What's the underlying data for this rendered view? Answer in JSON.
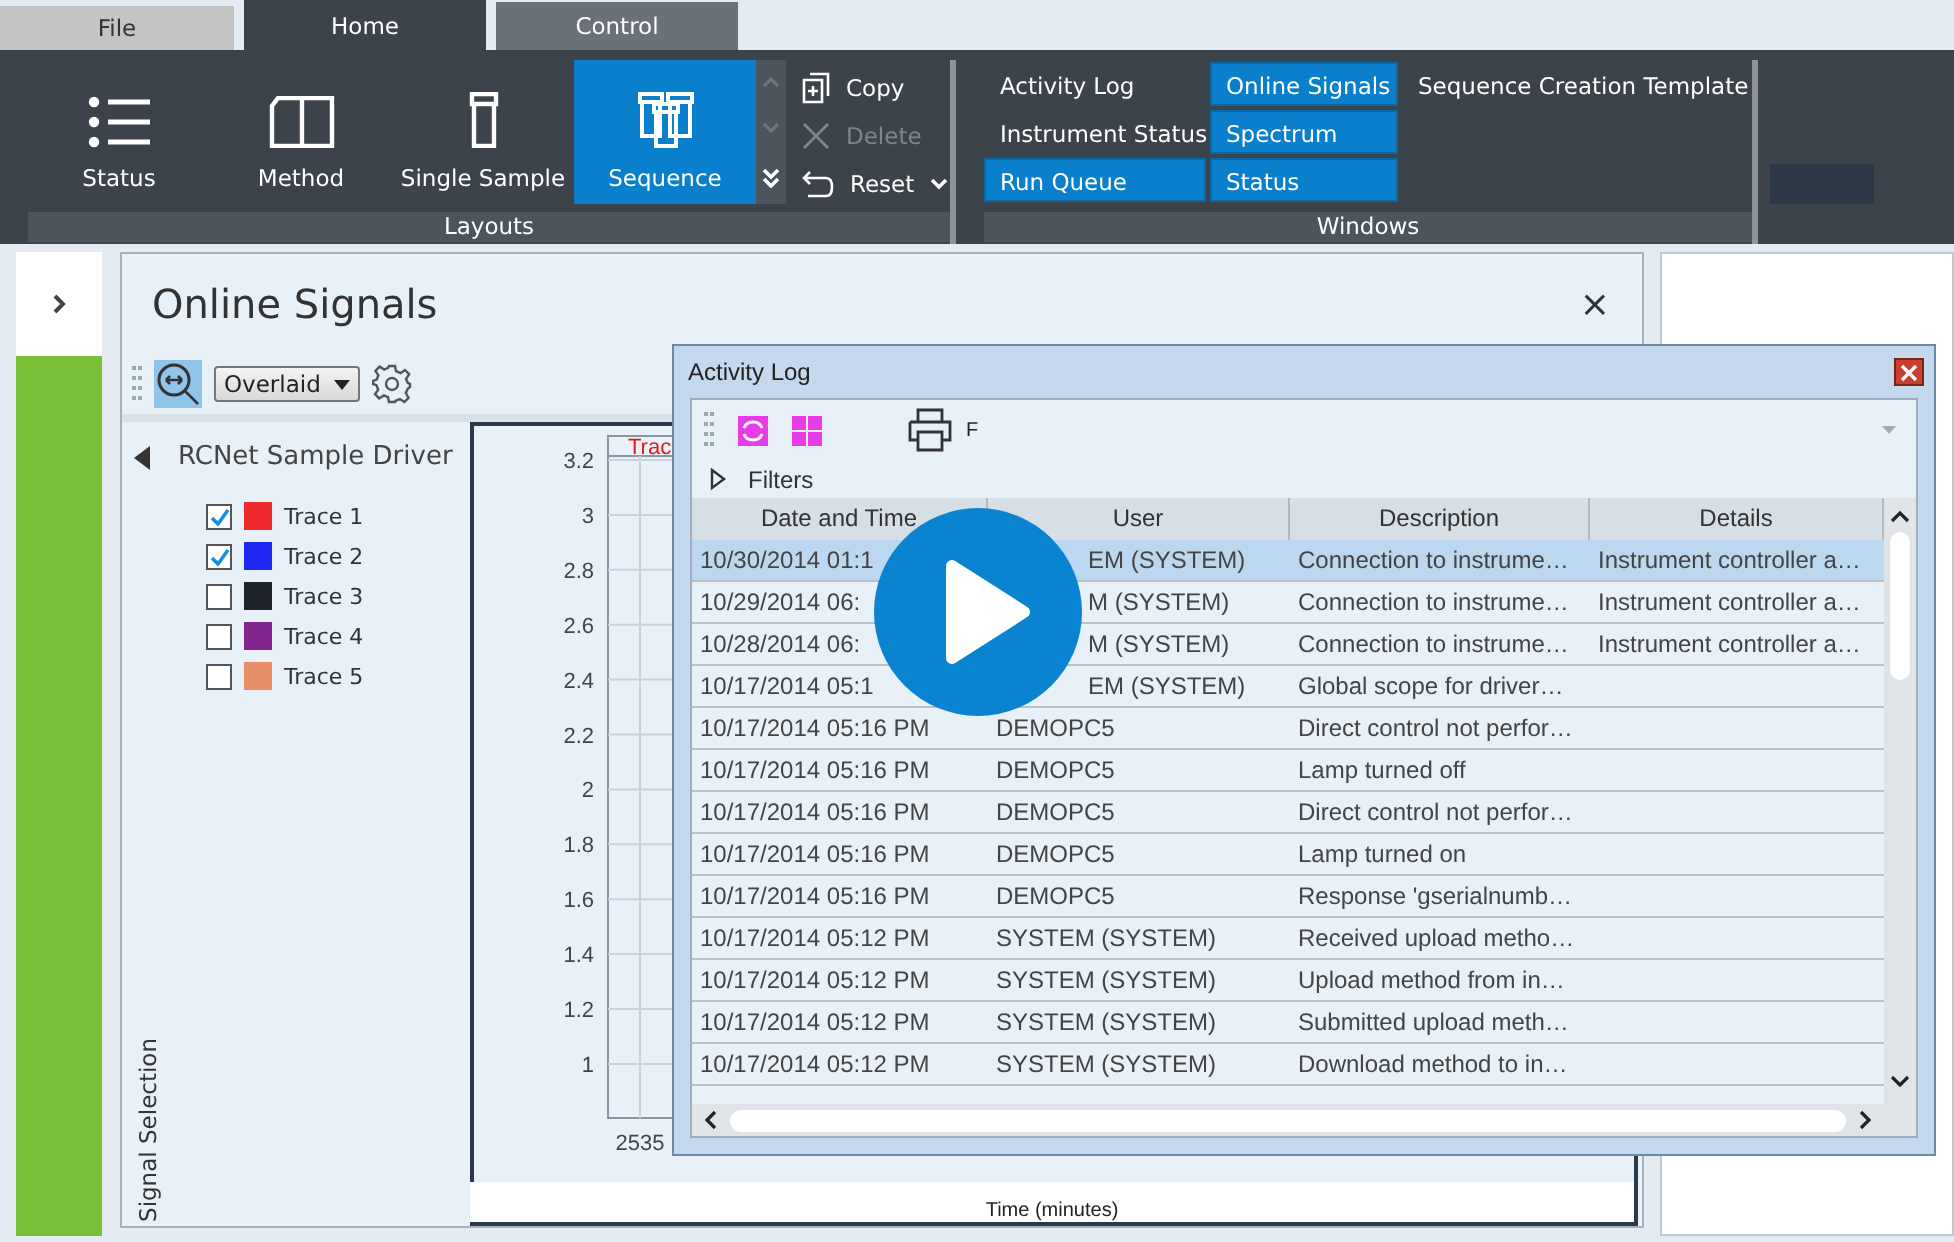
{
  "ribbon_tabs": [
    {
      "label": "File",
      "selected": false
    },
    {
      "label": "Home",
      "selected": true
    },
    {
      "label": "Control",
      "selected": false
    }
  ],
  "layouts": {
    "label": "Layouts",
    "buttons": [
      {
        "label": "Status",
        "selected": false
      },
      {
        "label": "Method",
        "selected": false
      },
      {
        "label": "Single Sample",
        "selected": false
      },
      {
        "label": "Sequence",
        "selected": true
      }
    ],
    "actions": [
      {
        "label": "Copy",
        "disabled": false
      },
      {
        "label": "Delete",
        "disabled": true
      },
      {
        "label": "Reset",
        "disabled": false
      }
    ]
  },
  "windows": {
    "label": "Windows",
    "columns": [
      [
        {
          "label": "Activity Log",
          "selected": false
        },
        {
          "label": "Instrument Status",
          "selected": false
        },
        {
          "label": "Run Queue",
          "selected": true
        }
      ],
      [
        {
          "label": "Online Signals",
          "selected": true
        },
        {
          "label": "Spectrum",
          "selected": true
        },
        {
          "label": "Status",
          "selected": true
        }
      ],
      [
        {
          "label": "Sequence Creation Template",
          "selected": false
        }
      ]
    ]
  },
  "online_signals": {
    "title": "Online Signals",
    "close": "×",
    "view_mode": "Overlaid",
    "driver": "RCNet Sample Driver",
    "side_label": "Signal Selection",
    "traces": [
      {
        "label": "Trace 1",
        "checked": true,
        "color": "#ee2a2e"
      },
      {
        "label": "Trace 2",
        "checked": true,
        "color": "#1f27f5"
      },
      {
        "label": "Trace 3",
        "checked": false,
        "color": "#1e2229"
      },
      {
        "label": "Trace 4",
        "checked": false,
        "color": "#822390"
      },
      {
        "label": "Trace 5",
        "checked": false,
        "color": "#e88e68"
      }
    ],
    "plot": {
      "legend_label": "Trac",
      "y_ticks": [
        "3.2",
        "3",
        "2.8",
        "2.6",
        "2.4",
        "2.2",
        "2",
        "1.8",
        "1.6",
        "1.4",
        "1.2",
        "1"
      ],
      "x_ticks": [
        "2535"
      ],
      "x_label": "Time (minutes)"
    }
  },
  "activity_log": {
    "title": "Activity Log",
    "toolbar_text": "F",
    "filters": "Filters",
    "columns": [
      "Date and Time",
      "User",
      "Description",
      "Details"
    ],
    "rows": [
      {
        "cells": [
          "10/30/2014 01:1",
          "EM (SYSTEM)",
          "Connection to instrume…",
          "Instrument controller a…"
        ],
        "selected": true
      },
      {
        "cells": [
          "10/29/2014 06:",
          "M (SYSTEM)",
          "Connection to instrume…",
          "Instrument controller a…"
        ],
        "selected": false
      },
      {
        "cells": [
          "10/28/2014 06:",
          "M (SYSTEM)",
          "Connection to instrume…",
          "Instrument controller a…"
        ],
        "selected": false
      },
      {
        "cells": [
          "10/17/2014 05:1",
          "EM (SYSTEM)",
          "Global scope for driver…",
          ""
        ],
        "selected": false
      },
      {
        "cells": [
          "10/17/2014 05:16 PM",
          "DEMOPC5",
          "Direct control not perfor…",
          ""
        ],
        "selected": false
      },
      {
        "cells": [
          "10/17/2014 05:16 PM",
          "DEMOPC5",
          "Lamp turned off",
          ""
        ],
        "selected": false
      },
      {
        "cells": [
          "10/17/2014 05:16 PM",
          "DEMOPC5",
          "Direct control not perfor…",
          ""
        ],
        "selected": false
      },
      {
        "cells": [
          "10/17/2014 05:16 PM",
          "DEMOPC5",
          "Lamp turned on",
          ""
        ],
        "selected": false
      },
      {
        "cells": [
          "10/17/2014 05:16 PM",
          "DEMOPC5",
          "Response 'gserialnumb…",
          ""
        ],
        "selected": false
      },
      {
        "cells": [
          "10/17/2014 05:12 PM",
          "SYSTEM (SYSTEM)",
          "Received upload metho…",
          ""
        ],
        "selected": false
      },
      {
        "cells": [
          "10/17/2014 05:12 PM",
          "SYSTEM (SYSTEM)",
          "Upload method from in…",
          ""
        ],
        "selected": false
      },
      {
        "cells": [
          "10/17/2014 05:12 PM",
          "SYSTEM (SYSTEM)",
          "Submitted upload meth…",
          ""
        ],
        "selected": false
      },
      {
        "cells": [
          "10/17/2014 05:12 PM",
          "SYSTEM (SYSTEM)",
          "Download method to in…",
          ""
        ],
        "selected": false
      }
    ]
  }
}
